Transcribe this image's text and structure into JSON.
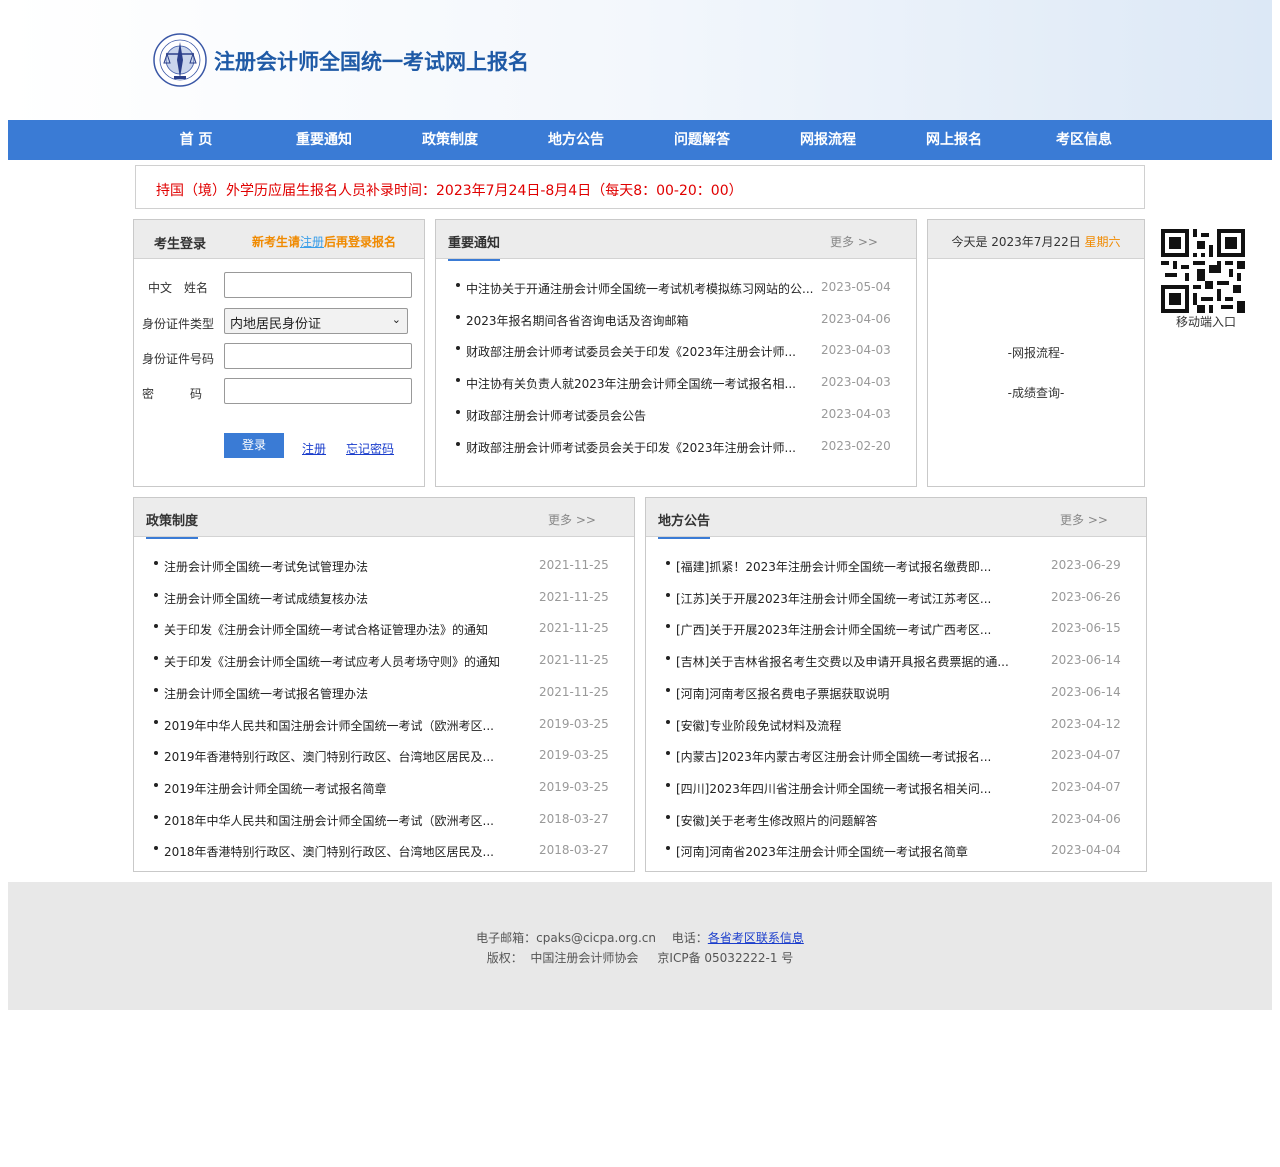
{
  "header": {
    "title": "注册会计师全国统一考试网上报名"
  },
  "nav": [
    "首 页",
    "重要通知",
    "政策制度",
    "地方公告",
    "问题解答",
    "网报流程",
    "网上报名",
    "考区信息"
  ],
  "notice": "持国（境）外学历应届生报名人员补录时间：2023年7月24日-8月4日（每天8：00-20：00）",
  "login": {
    "title": "考生登录",
    "hint_prefix": "新考生请",
    "hint_link": "注册",
    "hint_suffix": "后再登录报名",
    "name_label": "中文　姓名",
    "idtype_label": "身份证件类型",
    "idtype_value": "内地居民身份证",
    "idno_label": "身份证件号码",
    "pwd_label": "密　　　码",
    "login_button": "登录",
    "register_link": "注册",
    "forgot_link": "忘记密码"
  },
  "important": {
    "title": "重要通知",
    "more": "更多 >>",
    "items": [
      {
        "title": "中注协关于开通注册会计师全国统一考试机考模拟练习网站的公...",
        "date": "2023-05-04"
      },
      {
        "title": "2023年报名期间各省咨询电话及咨询邮箱",
        "date": "2023-04-06"
      },
      {
        "title": "财政部注册会计师考试委员会关于印发《2023年注册会计师...",
        "date": "2023-04-03"
      },
      {
        "title": "中注协有关负责人就2023年注册会计师全国统一考试报名相...",
        "date": "2023-04-03"
      },
      {
        "title": "财政部注册会计师考试委员会公告",
        "date": "2023-04-03"
      },
      {
        "title": "财政部注册会计师考试委员会关于印发《2023年注册会计师...",
        "date": "2023-02-20"
      }
    ]
  },
  "today": {
    "prefix": "今天是 2023年7月22日 ",
    "weekday": "星期六",
    "link1": "-网报流程-",
    "link2": "-成绩查询-"
  },
  "qr": {
    "label": "移动端入口"
  },
  "policy": {
    "title": "政策制度",
    "more": "更多 >>",
    "items": [
      {
        "title": "注册会计师全国统一考试免试管理办法",
        "date": "2021-11-25"
      },
      {
        "title": "注册会计师全国统一考试成绩复核办法",
        "date": "2021-11-25"
      },
      {
        "title": "关于印发《注册会计师全国统一考试合格证管理办法》的通知",
        "date": "2021-11-25"
      },
      {
        "title": "关于印发《注册会计师全国统一考试应考人员考场守则》的通知",
        "date": "2021-11-25"
      },
      {
        "title": "注册会计师全国统一考试报名管理办法",
        "date": "2021-11-25"
      },
      {
        "title": "2019年中华人民共和国注册会计师全国统一考试（欧洲考区...",
        "date": "2019-03-25"
      },
      {
        "title": "2019年香港特别行政区、澳门特别行政区、台湾地区居民及...",
        "date": "2019-03-25"
      },
      {
        "title": "2019年注册会计师全国统一考试报名简章",
        "date": "2019-03-25"
      },
      {
        "title": "2018年中华人民共和国注册会计师全国统一考试（欧洲考区...",
        "date": "2018-03-27"
      },
      {
        "title": "2018年香港特别行政区、澳门特别行政区、台湾地区居民及...",
        "date": "2018-03-27"
      }
    ]
  },
  "local": {
    "title": "地方公告",
    "more": "更多 >>",
    "items": [
      {
        "title": "[福建]抓紧！2023年注册会计师全国统一考试报名缴费即...",
        "date": "2023-06-29"
      },
      {
        "title": "[江苏]关于开展2023年注册会计师全国统一考试江苏考区...",
        "date": "2023-06-26"
      },
      {
        "title": "[广西]关于开展2023年注册会计师全国统一考试广西考区...",
        "date": "2023-06-15"
      },
      {
        "title": "[吉林]关于吉林省报名考生交费以及申请开具报名费票据的通...",
        "date": "2023-06-14"
      },
      {
        "title": "[河南]河南考区报名费电子票据获取说明",
        "date": "2023-06-14"
      },
      {
        "title": "[安徽]专业阶段免试材料及流程",
        "date": "2023-04-12"
      },
      {
        "title": "[内蒙古]2023年内蒙古考区注册会计师全国统一考试报名...",
        "date": "2023-04-07"
      },
      {
        "title": "[四川]2023年四川省注册会计师全国统一考试报名相关问...",
        "date": "2023-04-07"
      },
      {
        "title": "[安徽]关于老考生修改照片的问题解答",
        "date": "2023-04-06"
      },
      {
        "title": "[河南]河南省2023年注册会计师全国统一考试报名简章",
        "date": "2023-04-04"
      }
    ]
  },
  "footer": {
    "email_label": "电子邮箱：cpaks@cicpa.org.cn",
    "phone_label": "电话：",
    "phone_link": "各省考区联系信息",
    "copyright": "版权：  中国注册会计师协会     京ICP备 05032222-1 号"
  }
}
